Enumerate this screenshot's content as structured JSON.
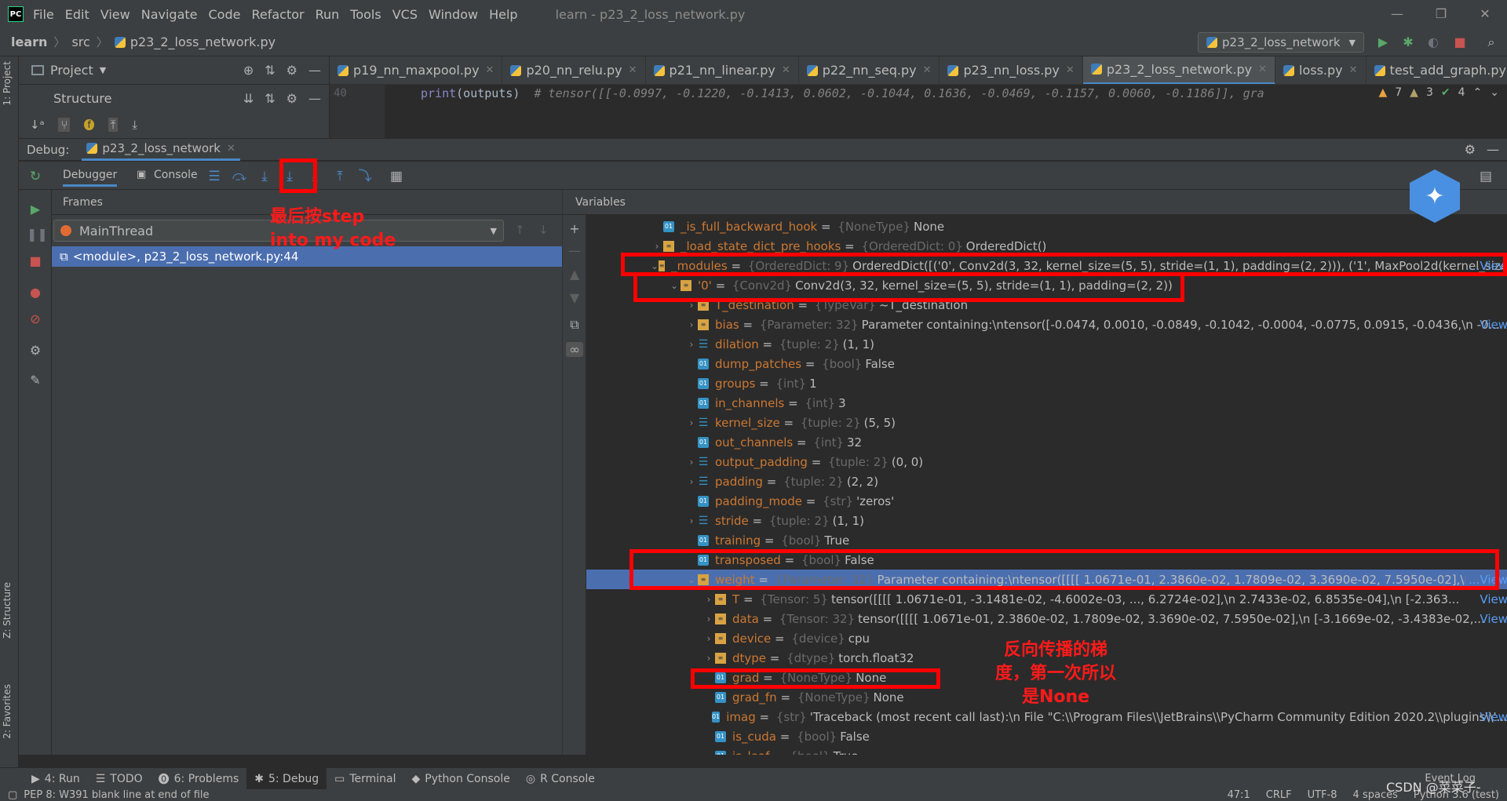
{
  "titlebar": {
    "logo": "PC",
    "menu": [
      "File",
      "Edit",
      "View",
      "Navigate",
      "Code",
      "Refactor",
      "Run",
      "Tools",
      "VCS",
      "Window",
      "Help"
    ],
    "window_title": "learn - p23_2_loss_network.py",
    "controls": [
      "—",
      "❐",
      "✕"
    ]
  },
  "navbar": {
    "crumbs": [
      "learn",
      "src",
      "p23_2_loss_network.py"
    ],
    "run_config": "p23_2_loss_network"
  },
  "left_stripe": {
    "project": "1: Project",
    "structure": "Z: Structure",
    "favorites": "2: Favorites"
  },
  "project_panel": {
    "title": "Project"
  },
  "structure_panel": {
    "title": "Structure"
  },
  "editor": {
    "tabs": [
      "p19_nn_maxpool.py",
      "p20_nn_relu.py",
      "p21_nn_linear.py",
      "p22_nn_seq.py",
      "p23_nn_loss.py",
      "p23_2_loss_network.py",
      "loss.py",
      "test_add_graph.py"
    ],
    "active_tab": 5,
    "line_number": "40",
    "code_fn": "print",
    "code_arg": "(outputs)",
    "code_comment": "# tensor([[-0.0997, -0.1220, -0.1413,  0.0602, -0.1044,  0.1636, -0.0469, -0.1157, 0.0060, -0.1186]], gra",
    "warnings": "7",
    "weak_warnings": "3",
    "ok": "4"
  },
  "debug": {
    "label": "Debug:",
    "session": "p23_2_loss_network",
    "tab_debugger": "Debugger",
    "tab_console": "Console",
    "frames_title": "Frames",
    "thread": "MainThread",
    "frame": "<module>, p23_2_loss_network.py:44",
    "variables_title": "Variables"
  },
  "variables": [
    {
      "indent": 0,
      "arrow": "",
      "icon": "p",
      "name": "_is_full_backward_hook",
      "type": "{NoneType}",
      "value": "None",
      "link": ""
    },
    {
      "indent": 0,
      "arrow": "›",
      "icon": "m",
      "name": "_load_state_dict_pre_hooks",
      "type": "{OrderedDict: 0}",
      "value": "OrderedDict()",
      "link": ""
    },
    {
      "indent": 0,
      "arrow": "⌄",
      "icon": "m",
      "name": "_modules",
      "type": "{OrderedDict: 9}",
      "value": "OrderedDict([('0', Conv2d(3, 32, kernel_size=(5, 5), stride=(1, 1), padding=(2, 2))), ('1', MaxPool2d(kernel_size",
      "link": "...View"
    },
    {
      "indent": 1,
      "arrow": "⌄",
      "icon": "m",
      "name": "'0'",
      "type": "{Conv2d}",
      "value": "Conv2d(3, 32, kernel_size=(5, 5), stride=(1, 1), padding=(2, 2))",
      "link": ""
    },
    {
      "indent": 2,
      "arrow": "›",
      "icon": "m",
      "name": "T_destination",
      "type": "{TypeVar}",
      "value": "~T_destination",
      "link": ""
    },
    {
      "indent": 2,
      "arrow": "›",
      "icon": "m",
      "name": "bias",
      "type": "{Parameter: 32}",
      "value": "Parameter containing:\\ntensor([-0.0474,  0.0010, -0.0849, -0.1042, -0.0004, -0.0775,  0.0915, -0.0436,\\n        -0...",
      "link": "View"
    },
    {
      "indent": 2,
      "arrow": "›",
      "icon": "l",
      "name": "dilation",
      "type": "{tuple: 2}",
      "value": "(1, 1)",
      "link": ""
    },
    {
      "indent": 2,
      "arrow": "",
      "icon": "p",
      "name": "dump_patches",
      "type": "{bool}",
      "value": "False",
      "link": ""
    },
    {
      "indent": 2,
      "arrow": "",
      "icon": "p",
      "name": "groups",
      "type": "{int}",
      "value": "1",
      "link": ""
    },
    {
      "indent": 2,
      "arrow": "",
      "icon": "p",
      "name": "in_channels",
      "type": "{int}",
      "value": "3",
      "link": ""
    },
    {
      "indent": 2,
      "arrow": "›",
      "icon": "l",
      "name": "kernel_size",
      "type": "{tuple: 2}",
      "value": "(5, 5)",
      "link": ""
    },
    {
      "indent": 2,
      "arrow": "",
      "icon": "p",
      "name": "out_channels",
      "type": "{int}",
      "value": "32",
      "link": ""
    },
    {
      "indent": 2,
      "arrow": "›",
      "icon": "l",
      "name": "output_padding",
      "type": "{tuple: 2}",
      "value": "(0, 0)",
      "link": ""
    },
    {
      "indent": 2,
      "arrow": "›",
      "icon": "l",
      "name": "padding",
      "type": "{tuple: 2}",
      "value": "(2, 2)",
      "link": ""
    },
    {
      "indent": 2,
      "arrow": "",
      "icon": "p",
      "name": "padding_mode",
      "type": "{str}",
      "value": "'zeros'",
      "link": ""
    },
    {
      "indent": 2,
      "arrow": "›",
      "icon": "l",
      "name": "stride",
      "type": "{tuple: 2}",
      "value": "(1, 1)",
      "link": ""
    },
    {
      "indent": 2,
      "arrow": "",
      "icon": "p",
      "name": "training",
      "type": "{bool}",
      "value": "True",
      "link": ""
    },
    {
      "indent": 2,
      "arrow": "",
      "icon": "p",
      "name": "transposed",
      "type": "{bool}",
      "value": "False",
      "link": ""
    },
    {
      "indent": 2,
      "arrow": "⌄",
      "icon": "m",
      "name": "weight",
      "type": "{Parameter: 32}",
      "value": "Parameter containing:\\ntensor([[[[ 1.0671e-01,  2.3860e-02,  1.7809e-02,  3.3690e-02,  7.5950e-02],\\n",
      "link": "...View"
    },
    {
      "indent": 3,
      "arrow": "›",
      "icon": "m",
      "name": "T",
      "type": "{Tensor: 5}",
      "value": "tensor([[[[ 1.0671e-01, -3.1481e-02, -4.6002e-03,  ...,  6.2724e-02],\\n          2.7433e-02,  6.8535e-04],\\n          [-2.363...",
      "link": "View"
    },
    {
      "indent": 3,
      "arrow": "›",
      "icon": "m",
      "name": "data",
      "type": "{Tensor: 32}",
      "value": "tensor([[[[ 1.0671e-01,  2.3860e-02,  1.7809e-02,  3.3690e-02,  7.5950e-02],\\n          [-3.1669e-02, -3.4383e-02,...",
      "link": "View"
    },
    {
      "indent": 3,
      "arrow": "›",
      "icon": "m",
      "name": "device",
      "type": "{device}",
      "value": "cpu",
      "link": ""
    },
    {
      "indent": 3,
      "arrow": "›",
      "icon": "m",
      "name": "dtype",
      "type": "{dtype}",
      "value": "torch.float32",
      "link": ""
    },
    {
      "indent": 3,
      "arrow": "",
      "icon": "p",
      "name": "grad",
      "type": "{NoneType}",
      "value": "None",
      "link": ""
    },
    {
      "indent": 3,
      "arrow": "",
      "icon": "p",
      "name": "grad_fn",
      "type": "{NoneType}",
      "value": "None",
      "link": ""
    },
    {
      "indent": 3,
      "arrow": "",
      "icon": "p",
      "name": "imag",
      "type": "{str}",
      "value": "'Traceback (most recent call last):\\n  File \"C:\\\\Program Files\\\\JetBrains\\\\PyCharm Community Edition 2020.2\\\\plugins\\\\'...",
      "link": "View"
    },
    {
      "indent": 3,
      "arrow": "",
      "icon": "p",
      "name": "is_cuda",
      "type": "{bool}",
      "value": "False",
      "link": ""
    },
    {
      "indent": 3,
      "arrow": "",
      "icon": "p",
      "name": "is_leaf",
      "type": "{bool}",
      "value": "True",
      "link": ""
    }
  ],
  "selected_variable": 18,
  "bottom_tabs": [
    {
      "icon": "▶",
      "label": "4: Run"
    },
    {
      "icon": "☰",
      "label": "TODO"
    },
    {
      "icon": "⓿",
      "label": "6: Problems"
    },
    {
      "icon": "✱",
      "label": "5: Debug"
    },
    {
      "icon": "▭",
      "label": "Terminal"
    },
    {
      "icon": "◆",
      "label": "Python Console"
    },
    {
      "icon": "◎",
      "label": "R Console"
    }
  ],
  "active_bottom_tab": 3,
  "status": {
    "message": "PEP 8: W391 blank line at end of file",
    "position": "47:1",
    "line_sep": "CRLF",
    "encoding": "UTF-8",
    "indent": "4 spaces",
    "interpreter": "Python 3.6 (test)",
    "event_log": "Event Log"
  },
  "annotations": {
    "step_note": "最后按step\ninto my code",
    "grad_note": "反向传播的梯\n度，第一次所以\n是None",
    "watermark": "CSDN @菜菜子-"
  },
  "colors": {
    "annotation": "#ff0000",
    "selection": "#4b6eaf",
    "accent": "#4a88c7"
  }
}
